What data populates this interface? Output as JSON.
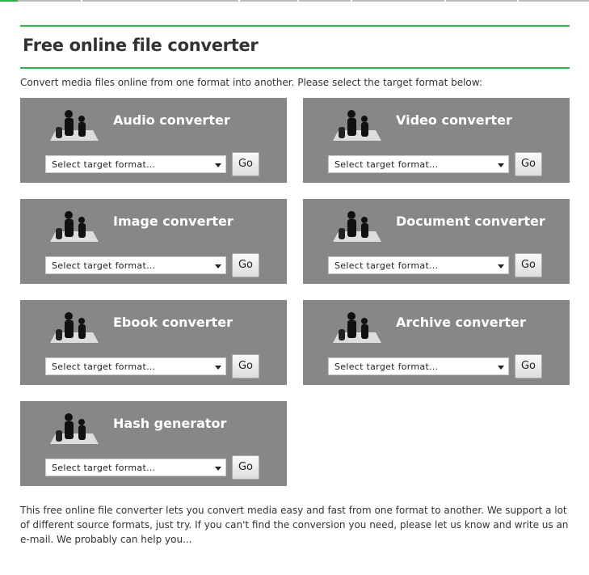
{
  "header": {
    "title": "Free online file converter",
    "intro": "Convert media files online from one format into another. Please select the target format below:"
  },
  "accent_color": "#2db34a",
  "panel_color": "#878787",
  "converters": [
    {
      "title": "Audio converter",
      "icon": "dancers-icon",
      "select": "Select target format...",
      "go": "Go"
    },
    {
      "title": "Video converter",
      "icon": "video-viewer-icon",
      "select": "Select target format...",
      "go": "Go"
    },
    {
      "title": "Image converter",
      "icon": "picture-frame-icon",
      "select": "Select target format...",
      "go": "Go"
    },
    {
      "title": "Document converter",
      "icon": "computer-user-icon",
      "select": "Select target format...",
      "go": "Go"
    },
    {
      "title": "Ebook converter",
      "icon": "reader-icon",
      "select": "Select target format...",
      "go": "Go"
    },
    {
      "title": "Archive converter",
      "icon": "packing-person-icon",
      "select": "Select target format...",
      "go": "Go"
    },
    {
      "title": "Hash generator",
      "icon": "hash-writer-icon",
      "select": "Select target format...",
      "go": "Go"
    }
  ],
  "footer": {
    "text": "This free online file converter lets you convert media easy and fast from one format to another. We support a lot of different source formats, just try. If you can't find the conversion you need, please let us know and write us an e-mail. We probably can help you..."
  }
}
